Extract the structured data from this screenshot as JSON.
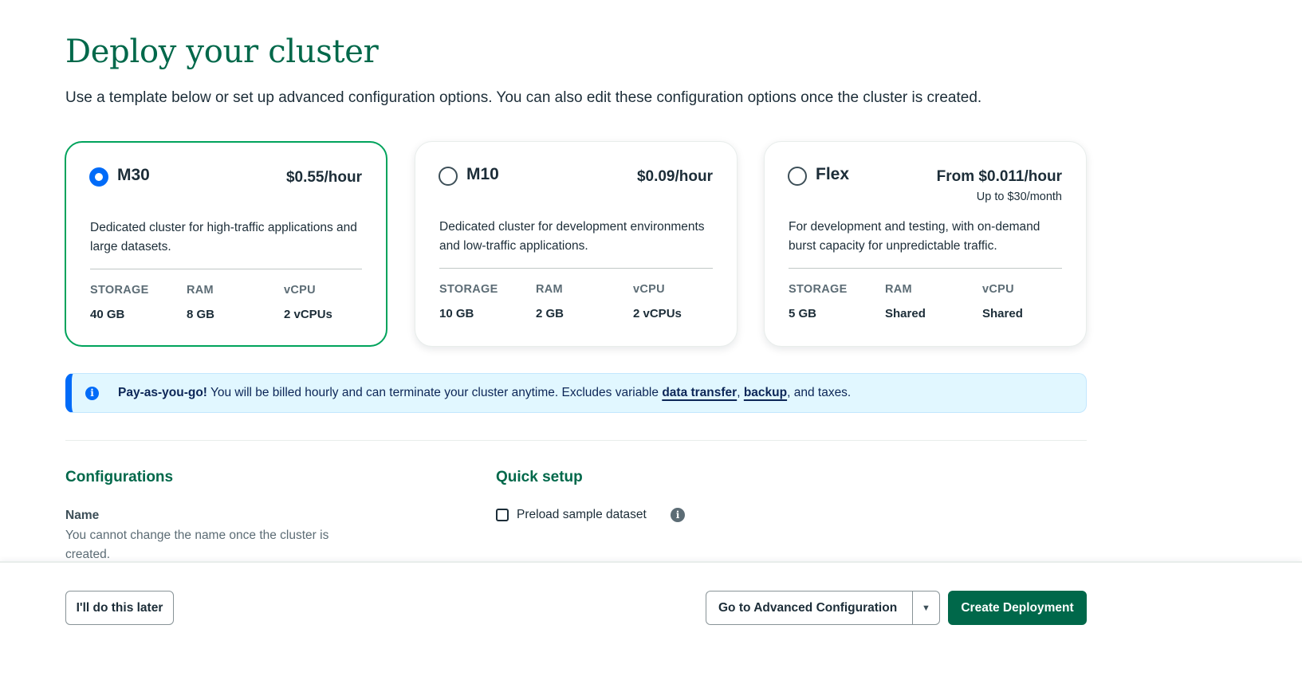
{
  "page": {
    "title": "Deploy your cluster",
    "subtitle": "Use a template below or set up advanced configuration options. You can also edit these configuration options once the cluster is created."
  },
  "tiers": [
    {
      "name": "M30",
      "price": "$0.55/hour",
      "price_sub": "",
      "selected": true,
      "description": "Dedicated cluster for high-traffic applications and large datasets.",
      "specs": {
        "storage_label": "STORAGE",
        "ram_label": "RAM",
        "vcpu_label": "vCPU",
        "storage": "40 GB",
        "ram": "8 GB",
        "vcpu": "2 vCPUs"
      }
    },
    {
      "name": "M10",
      "price": "$0.09/hour",
      "price_sub": "",
      "selected": false,
      "description": "Dedicated cluster for development environments and low-traffic applications.",
      "specs": {
        "storage_label": "STORAGE",
        "ram_label": "RAM",
        "vcpu_label": "vCPU",
        "storage": "10 GB",
        "ram": "2 GB",
        "vcpu": "2 vCPUs"
      }
    },
    {
      "name": "Flex",
      "price": "From $0.011/hour",
      "price_sub": "Up to $30/month",
      "selected": false,
      "description": "For development and testing, with on-demand burst capacity for unpredictable traffic.",
      "specs": {
        "storage_label": "STORAGE",
        "ram_label": "RAM",
        "vcpu_label": "vCPU",
        "storage": "5 GB",
        "ram": "Shared",
        "vcpu": "Shared"
      }
    }
  ],
  "banner": {
    "icon": "info-icon",
    "strong": "Pay-as-you-go!",
    "text": "You will be billed hourly and can terminate your cluster anytime. Excludes variable",
    "link1": "data transfer",
    "sep": ",",
    "link2": "backup",
    "tail": ", and taxes."
  },
  "configurations": {
    "heading": "Configurations",
    "name_label": "Name",
    "name_desc": "You cannot change the name once the cluster is created."
  },
  "quick_setup": {
    "heading": "Quick setup",
    "preload_label": "Preload sample dataset",
    "preload_checked": false,
    "help_icon": "info-icon"
  },
  "footer": {
    "later_label": "I'll do this later",
    "advanced_label": "Go to Advanced Configuration",
    "advanced_caret": "▼",
    "create_label": "Create Deployment"
  },
  "colors": {
    "brand_green": "#00684a",
    "selected_border": "#00a35c",
    "radio_blue": "#016bf8",
    "banner_bg": "#e1f7ff"
  }
}
